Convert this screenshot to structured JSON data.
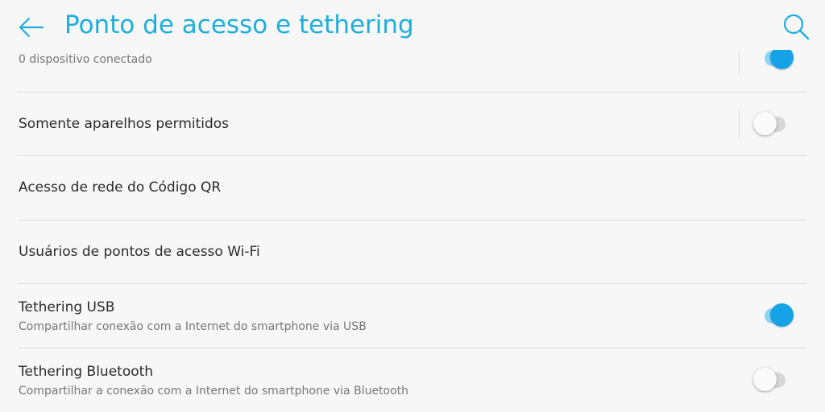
{
  "header": {
    "title": "Ponto de acesso e tethering",
    "back_icon": "arrow-left-icon",
    "search_icon": "search-icon",
    "accent_color": "#1eaedc"
  },
  "rows": [
    {
      "subtitle": "0 dispositivo conectado",
      "toggle": true
    },
    {
      "title": "Somente aparelhos permitidos",
      "toggle": false
    },
    {
      "title": "Acesso de rede do Código QR"
    },
    {
      "title": "Usuários de pontos de acesso Wi-Fi"
    },
    {
      "title": "Tethering USB",
      "subtitle": "Compartilhar conexão com a Internet do smartphone via USB",
      "toggle": true
    },
    {
      "title": "Tethering Bluetooth",
      "subtitle": "Compartilhar a conexão com a Internet do smartphone via Bluetooth",
      "toggle": false
    }
  ],
  "colors": {
    "toggle_on_thumb": "#16a2e6",
    "toggle_on_track": "#8ed3f1",
    "toggle_off_track": "#d7d7d7"
  }
}
